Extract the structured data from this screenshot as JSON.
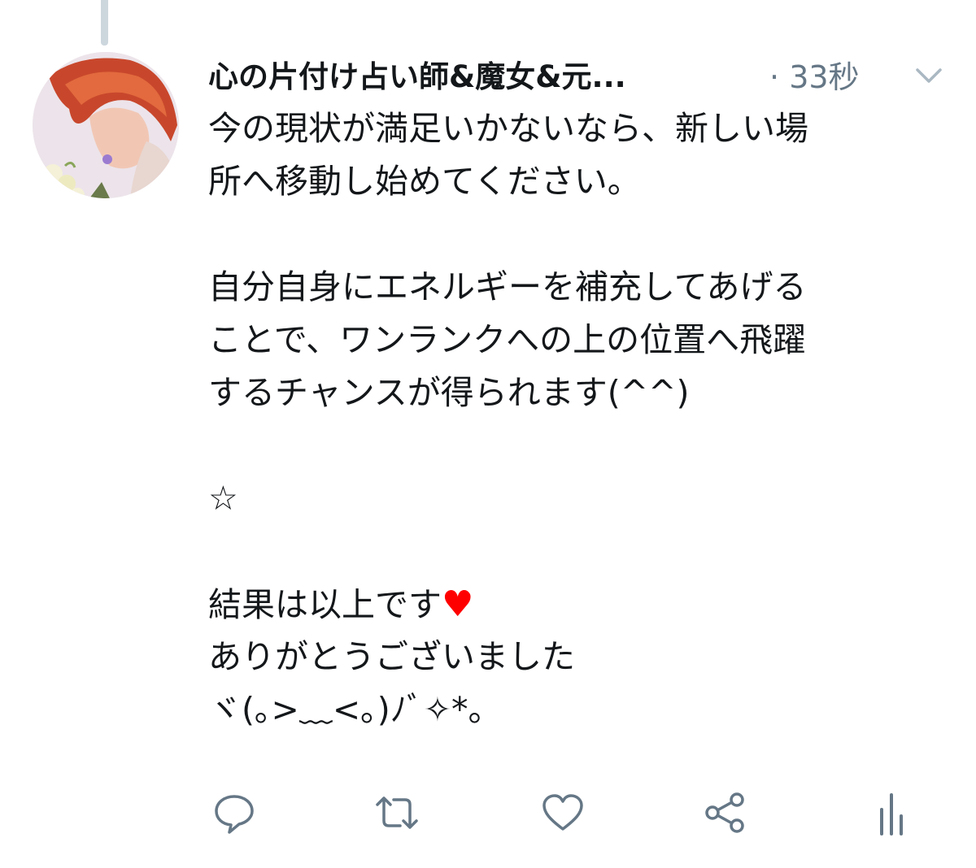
{
  "tweet": {
    "display_name": "心の片付け占い師&魔女&元...",
    "separator": "·",
    "timestamp": "33秒",
    "more_menu_icon": "chevron-down-icon",
    "avatar_icon": "user-avatar",
    "text_lines": [
      "今の現状が満足いかないなら、新しい場",
      "所へ移動し始めてください。",
      "",
      "自分自身にエネルギーを補充してあげる",
      "ことで、ワンランクへの上の位置へ飛躍",
      "するチャンスが得られます(^^)",
      "",
      "☆",
      "",
      "結果は以上です",
      "ありがとうございました",
      "ヾ(｡>﹏<｡)ﾉﾞ✧*。"
    ],
    "heart_emoji": "♥",
    "heart_color": "#ff0000"
  },
  "actions": [
    {
      "name": "reply-button",
      "icon": "reply-icon"
    },
    {
      "name": "retweet-button",
      "icon": "retweet-icon"
    },
    {
      "name": "like-button",
      "icon": "heart-icon"
    },
    {
      "name": "share-button",
      "icon": "share-icon"
    },
    {
      "name": "analytics-button",
      "icon": "analytics-icon"
    }
  ],
  "colors": {
    "text": "#14171a",
    "secondary": "#657786",
    "thread_line": "#ccd6dd"
  }
}
